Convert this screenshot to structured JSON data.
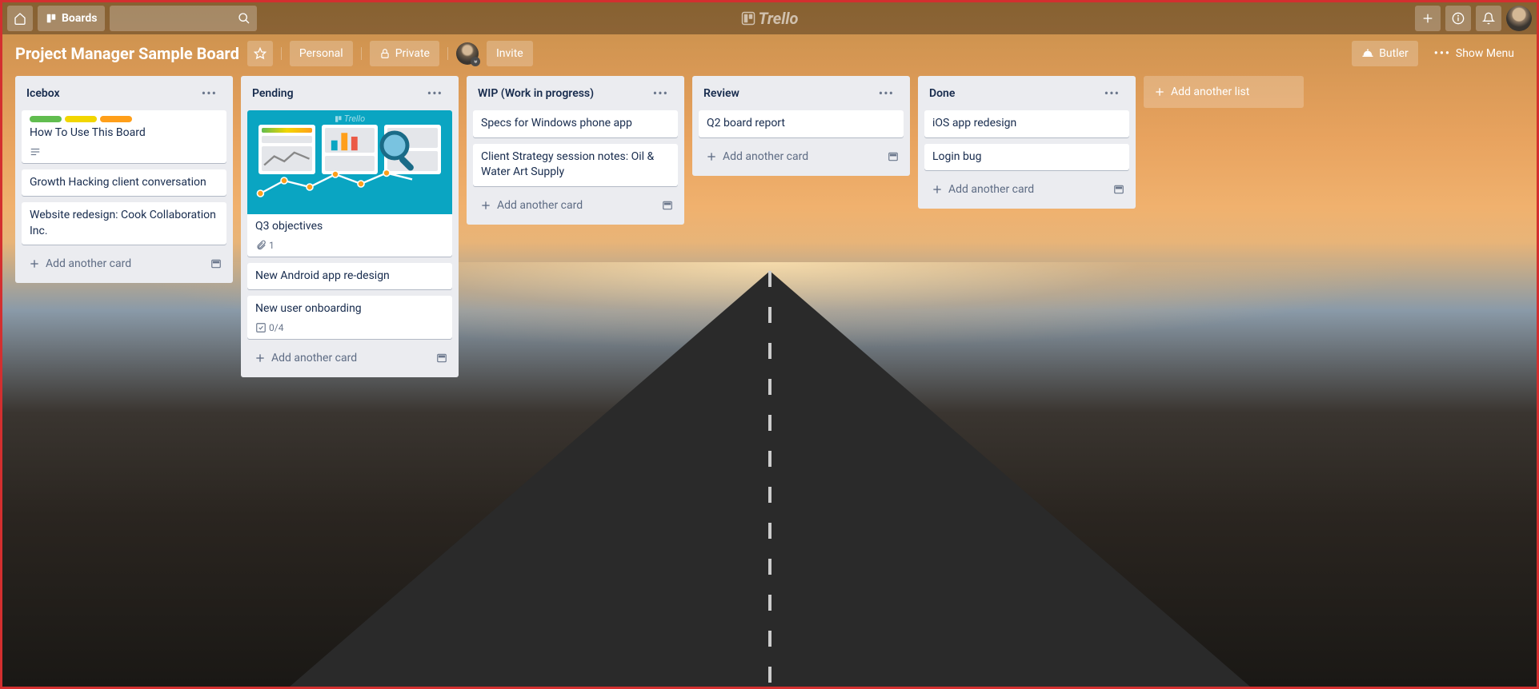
{
  "app_name": "Trello",
  "topbar": {
    "boards_label": "Boards"
  },
  "boardbar": {
    "title": "Project Manager Sample Board",
    "personal_label": "Personal",
    "private_label": "Private",
    "invite_label": "Invite",
    "butler_label": "Butler",
    "show_menu_label": "Show Menu"
  },
  "labels": {
    "green": "#61bd4f",
    "yellow": "#f2d600",
    "orange": "#ff9f1a"
  },
  "lists": [
    {
      "title": "Icebox",
      "cards": [
        {
          "title": "How To Use This Board",
          "labels": [
            "green",
            "yellow",
            "orange"
          ],
          "has_description": true
        },
        {
          "title": "Growth Hacking client conversation"
        },
        {
          "title": "Website redesign: Cook Collaboration Inc."
        }
      ]
    },
    {
      "title": "Pending",
      "cards": [
        {
          "title": "Q3 objectives",
          "has_cover": true,
          "attachments": 1
        },
        {
          "title": "New Android app re-design"
        },
        {
          "title": "New user onboarding",
          "checklist": "0/4"
        }
      ]
    },
    {
      "title": "WIP (Work in progress)",
      "cards": [
        {
          "title": "Specs for Windows phone app"
        },
        {
          "title": "Client Strategy session notes: Oil & Water Art Supply"
        }
      ]
    },
    {
      "title": "Review",
      "cards": [
        {
          "title": "Q2 board report"
        }
      ]
    },
    {
      "title": "Done",
      "cards": [
        {
          "title": "iOS app redesign"
        },
        {
          "title": "Login bug"
        }
      ]
    }
  ],
  "add_card_label": "Add another card",
  "add_list_label": "Add another list"
}
